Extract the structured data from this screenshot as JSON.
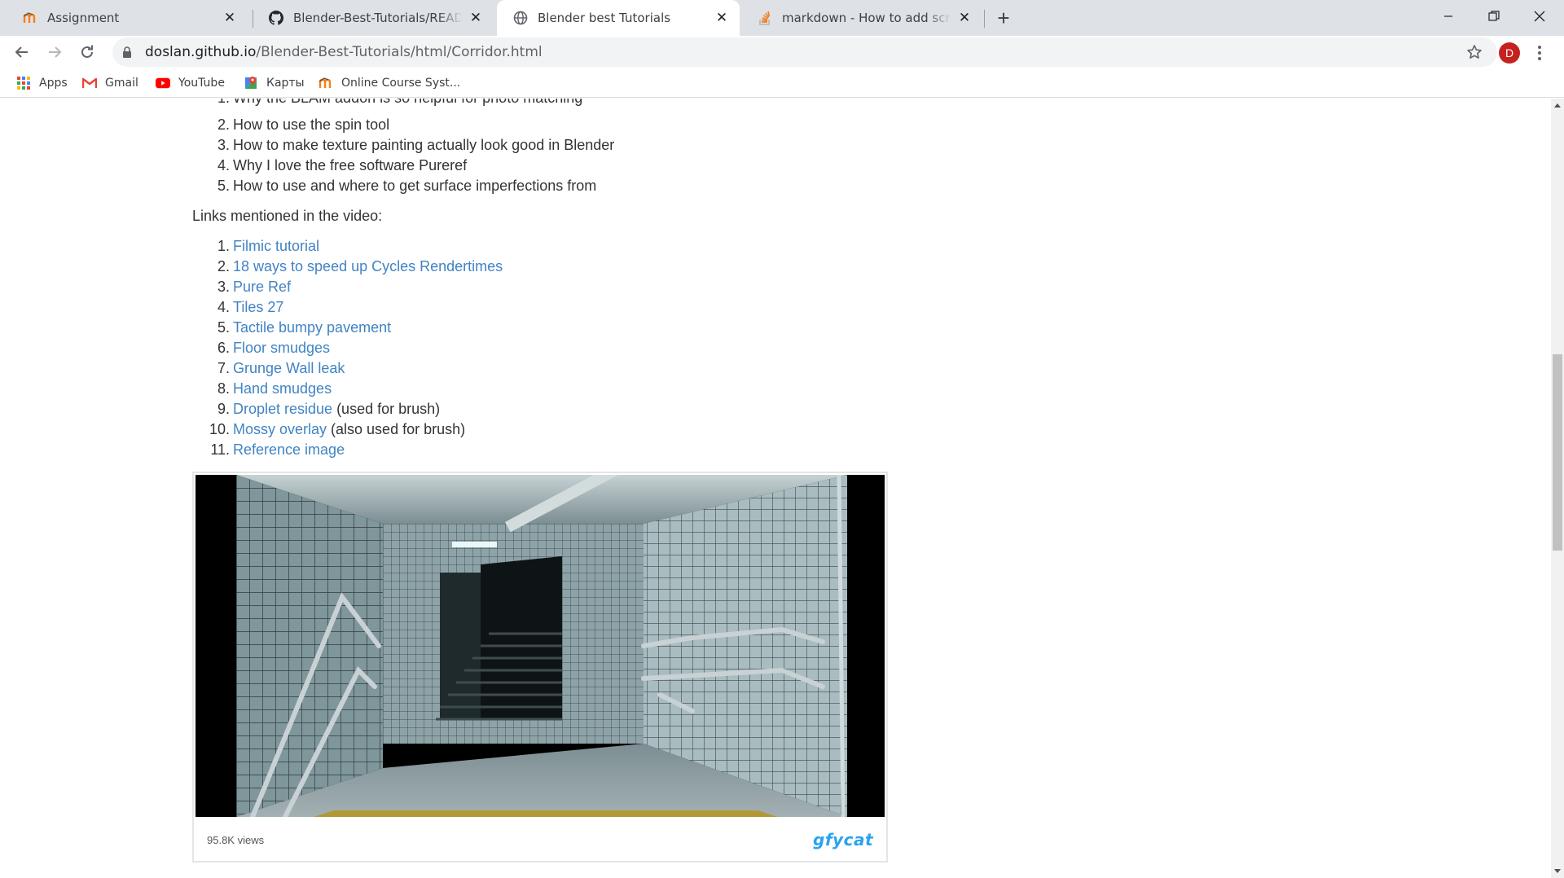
{
  "browser": {
    "tabs": [
      {
        "title": "Assignment",
        "favicon": "moodle-icon"
      },
      {
        "title": "Blender-Best-Tutorials/README.md",
        "favicon": "github-icon"
      },
      {
        "title": "Blender best Tutorials",
        "favicon": "globe-icon"
      },
      {
        "title": "markdown - How to add screenshot",
        "favicon": "stackoverflow-icon"
      }
    ],
    "active_tab": 2,
    "url_host": "doslan.github.io",
    "url_path": "/Blender-Best-Tutorials/html/Corridor.html",
    "profile_initial": "D",
    "bookmarks": [
      {
        "label": "Apps",
        "icon": "apps-grid-icon"
      },
      {
        "label": "Gmail",
        "icon": "gmail-icon"
      },
      {
        "label": "YouTube",
        "icon": "youtube-icon"
      },
      {
        "label": "Карты",
        "icon": "maps-icon"
      },
      {
        "label": "Online Course Syst...",
        "icon": "moodle-icon"
      }
    ]
  },
  "page": {
    "topics_partial": "Why the BLAM addon is so helpful for photo matching",
    "topics": [
      {
        "num": "2.",
        "text": "How to use the spin tool"
      },
      {
        "num": "3.",
        "text": "How to make texture painting actually look good in Blender"
      },
      {
        "num": "4.",
        "text": "Why I love the free software Pureref"
      },
      {
        "num": "5.",
        "text": "How to use and where to get surface imperfections from"
      }
    ],
    "links_heading": "Links mentioned in the video:",
    "links": [
      {
        "num": "1.",
        "label": "Filmic tutorial",
        "suffix": ""
      },
      {
        "num": "2.",
        "label": "18 ways to speed up Cycles Rendertimes",
        "suffix": ""
      },
      {
        "num": "3.",
        "label": "Pure Ref",
        "suffix": ""
      },
      {
        "num": "4.",
        "label": "Tiles 27",
        "suffix": ""
      },
      {
        "num": "5.",
        "label": "Tactile bumpy pavement",
        "suffix": ""
      },
      {
        "num": "6.",
        "label": "Floor smudges",
        "suffix": ""
      },
      {
        "num": "7.",
        "label": "Grunge Wall leak",
        "suffix": ""
      },
      {
        "num": "8.",
        "label": "Hand smudges",
        "suffix": ""
      },
      {
        "num": "9.",
        "label": "Droplet residue",
        "suffix": " (used for brush)"
      },
      {
        "num": "10.",
        "label": "Mossy overlay",
        "suffix": " (also used for brush)"
      },
      {
        "num": "11.",
        "label": "Reference image",
        "suffix": ""
      }
    ],
    "embed": {
      "views": "95.8K views",
      "brand": "gfycat"
    }
  },
  "colors": {
    "link": "#4183c4",
    "text": "#333333",
    "tabstrip": "#dee1e6",
    "brand": "#2aa3ef"
  }
}
